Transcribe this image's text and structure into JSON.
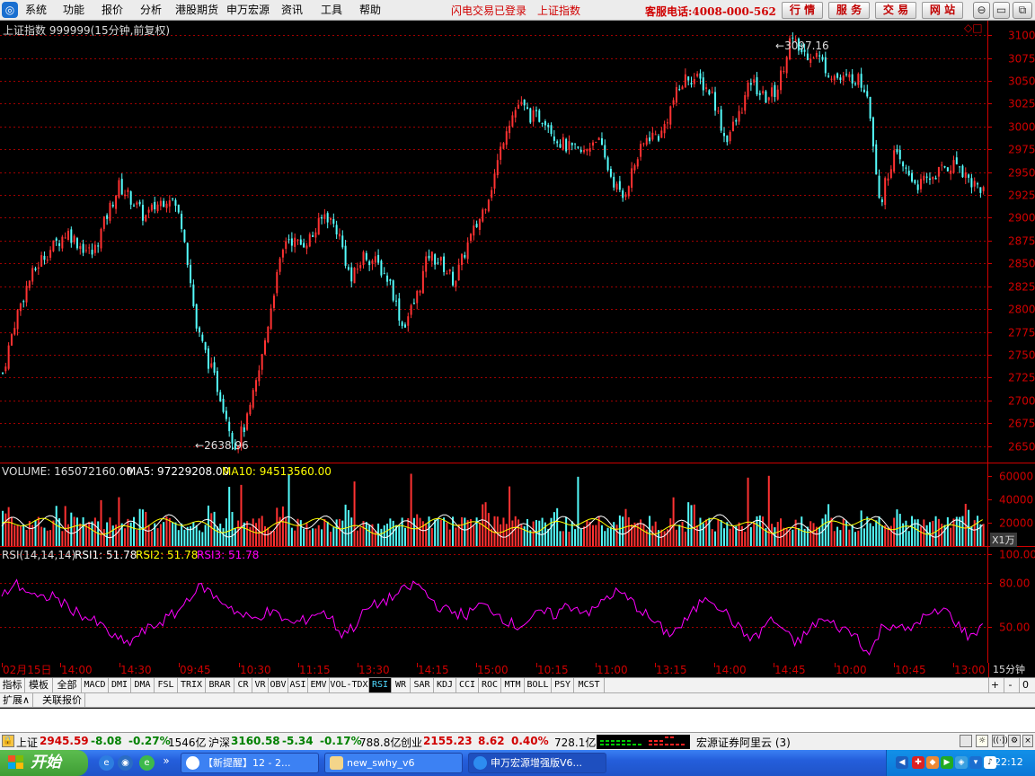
{
  "menubar": {
    "items": [
      "系统",
      "功能",
      "报价",
      "分析",
      "港股期货",
      "申万宏源",
      "资讯",
      "工具",
      "帮助"
    ],
    "links": [
      "闪电交易已登录",
      "上证指数"
    ],
    "hotline": "客服电话:4008-000-562",
    "buttons": [
      "行 情",
      "服 务",
      "交 易",
      "网 站"
    ],
    "window_controls": [
      "⊖",
      "▭",
      "⧉",
      "✕"
    ]
  },
  "main": {
    "title": "上证指数 999999(15分钟,前复权)",
    "high_label": "3097.16",
    "low_label": "2638.96",
    "corner_icons": "◇□"
  },
  "volume": {
    "label": "VOLUME: 165072160.00",
    "ma5": "MA5: 97229208.00",
    "ma10": "MA10: 94513560.00",
    "unit": "X1万"
  },
  "rsi": {
    "label": "RSI(14,14,14)",
    "rsi1": "RSI1: 51.78",
    "rsi2": "RSI2: 51.78",
    "rsi3": "RSI3: 51.78"
  },
  "time_axis": [
    "02月15日",
    "14:00",
    "14:30",
    "09:45",
    "10:30",
    "11:15",
    "13:30",
    "14:15",
    "15:00",
    "10:15",
    "11:00",
    "13:15",
    "14:00",
    "14:45",
    "10:00",
    "10:45",
    "13:00"
  ],
  "timeframe": "15分钟",
  "indicator_tabs": [
    "指标",
    "模板",
    "全部",
    "MACD",
    "DMI",
    "DMA",
    "FSL",
    "TRIX",
    "BRAR",
    "CR",
    "VR",
    "OBV",
    "ASI",
    "EMV",
    "VOL-TDX",
    "RSI",
    "WR",
    "SAR",
    "KDJ",
    "CCI",
    "ROC",
    "MTM",
    "BOLL",
    "PSY",
    "MCST"
  ],
  "active_indicator": "RSI",
  "indicator_controls": [
    "+",
    "-",
    "0"
  ],
  "sub_tabs": [
    "扩展∧",
    "关联报价"
  ],
  "status": {
    "sh_label": "上证",
    "sh_value": "2945.59",
    "sh_change": "-8.08",
    "sh_pct": "-0.27%",
    "sh_amount": "1546亿",
    "hs_label": "沪深",
    "hs_value": "3160.58",
    "hs_change": "-5.34",
    "hs_pct": "-0.17%",
    "hs_amount": "788.8亿",
    "cy_label": "创业",
    "cy_value": "2155.23",
    "cy_change": "8.62",
    "cy_pct": "0.40%",
    "cy_amount": "728.1亿",
    "broker": "宏源证券阿里云 (3)"
  },
  "taskbar": {
    "start": "开始",
    "tasks": [
      "【新提醒】12 - 2...",
      "new_swhy_v6",
      "申万宏源增强版V6..."
    ],
    "clock": "22:12"
  },
  "colors": {
    "up": "#ff3232",
    "down": "#54fcfc",
    "grid": "#a00000",
    "ma5": "#ffffff",
    "ma10": "#ffff00",
    "rsi": "#ff00ff",
    "axis": "#d00000"
  },
  "chart_data": [
    {
      "type": "candlestick",
      "title": "上证指数 999999(15分钟,前复权)",
      "y_ticks": [
        2650,
        2675,
        2700,
        2725,
        2750,
        2775,
        2800,
        2825,
        2850,
        2875,
        2900,
        2925,
        2950,
        2975,
        3000,
        3025,
        3050,
        3075,
        3100
      ],
      "ylim": [
        2632,
        3108
      ],
      "high": 3097.16,
      "low": 2638.96,
      "close_series": [
        2730,
        2790,
        2830,
        2855,
        2870,
        2885,
        2870,
        2860,
        2900,
        2935,
        2920,
        2900,
        2915,
        2925,
        2890,
        2780,
        2740,
        2700,
        2650,
        2680,
        2740,
        2820,
        2880,
        2870,
        2880,
        2905,
        2885,
        2830,
        2860,
        2850,
        2830,
        2780,
        2810,
        2860,
        2850,
        2830,
        2870,
        2900,
        2940,
        3000,
        3025,
        3010,
        3010,
        2985,
        2975,
        2970,
        2990,
        2950,
        2920,
        2960,
        2990,
        2990,
        3030,
        3055,
        3050,
        3035,
        2985,
        3010,
        3050,
        3030,
        3040,
        3095,
        3080,
        3080,
        3060,
        3050,
        3055,
        3040,
        2915,
        2970,
        2950,
        2935,
        2945,
        2955,
        2960,
        2940,
        2930
      ]
    },
    {
      "type": "bar",
      "title": "VOLUME",
      "y_ticks": [
        20000,
        40000,
        60000
      ],
      "ylim": [
        0,
        67000
      ],
      "unit": "X1万"
    },
    {
      "type": "line",
      "title": "RSI(14,14,14)",
      "y_ticks": [
        50,
        80,
        100
      ],
      "ylim": [
        25,
        105
      ],
      "values": [
        70,
        80,
        75,
        68,
        72,
        65,
        60,
        55,
        50,
        42,
        38,
        45,
        50,
        55,
        60,
        72,
        78,
        70,
        65,
        58,
        55,
        60,
        58,
        52,
        54,
        60,
        58,
        45,
        50,
        62,
        66,
        70,
        75,
        80,
        70,
        62,
        60,
        58,
        65,
        62,
        55,
        50,
        55,
        60,
        58,
        65,
        62,
        60,
        70,
        74,
        68,
        60,
        52,
        45,
        50,
        60,
        72,
        65,
        55,
        45,
        42,
        55,
        50,
        38,
        45,
        55,
        52,
        48,
        44,
        30,
        50,
        52,
        46,
        55,
        58,
        62,
        52,
        42,
        52
      ]
    }
  ]
}
